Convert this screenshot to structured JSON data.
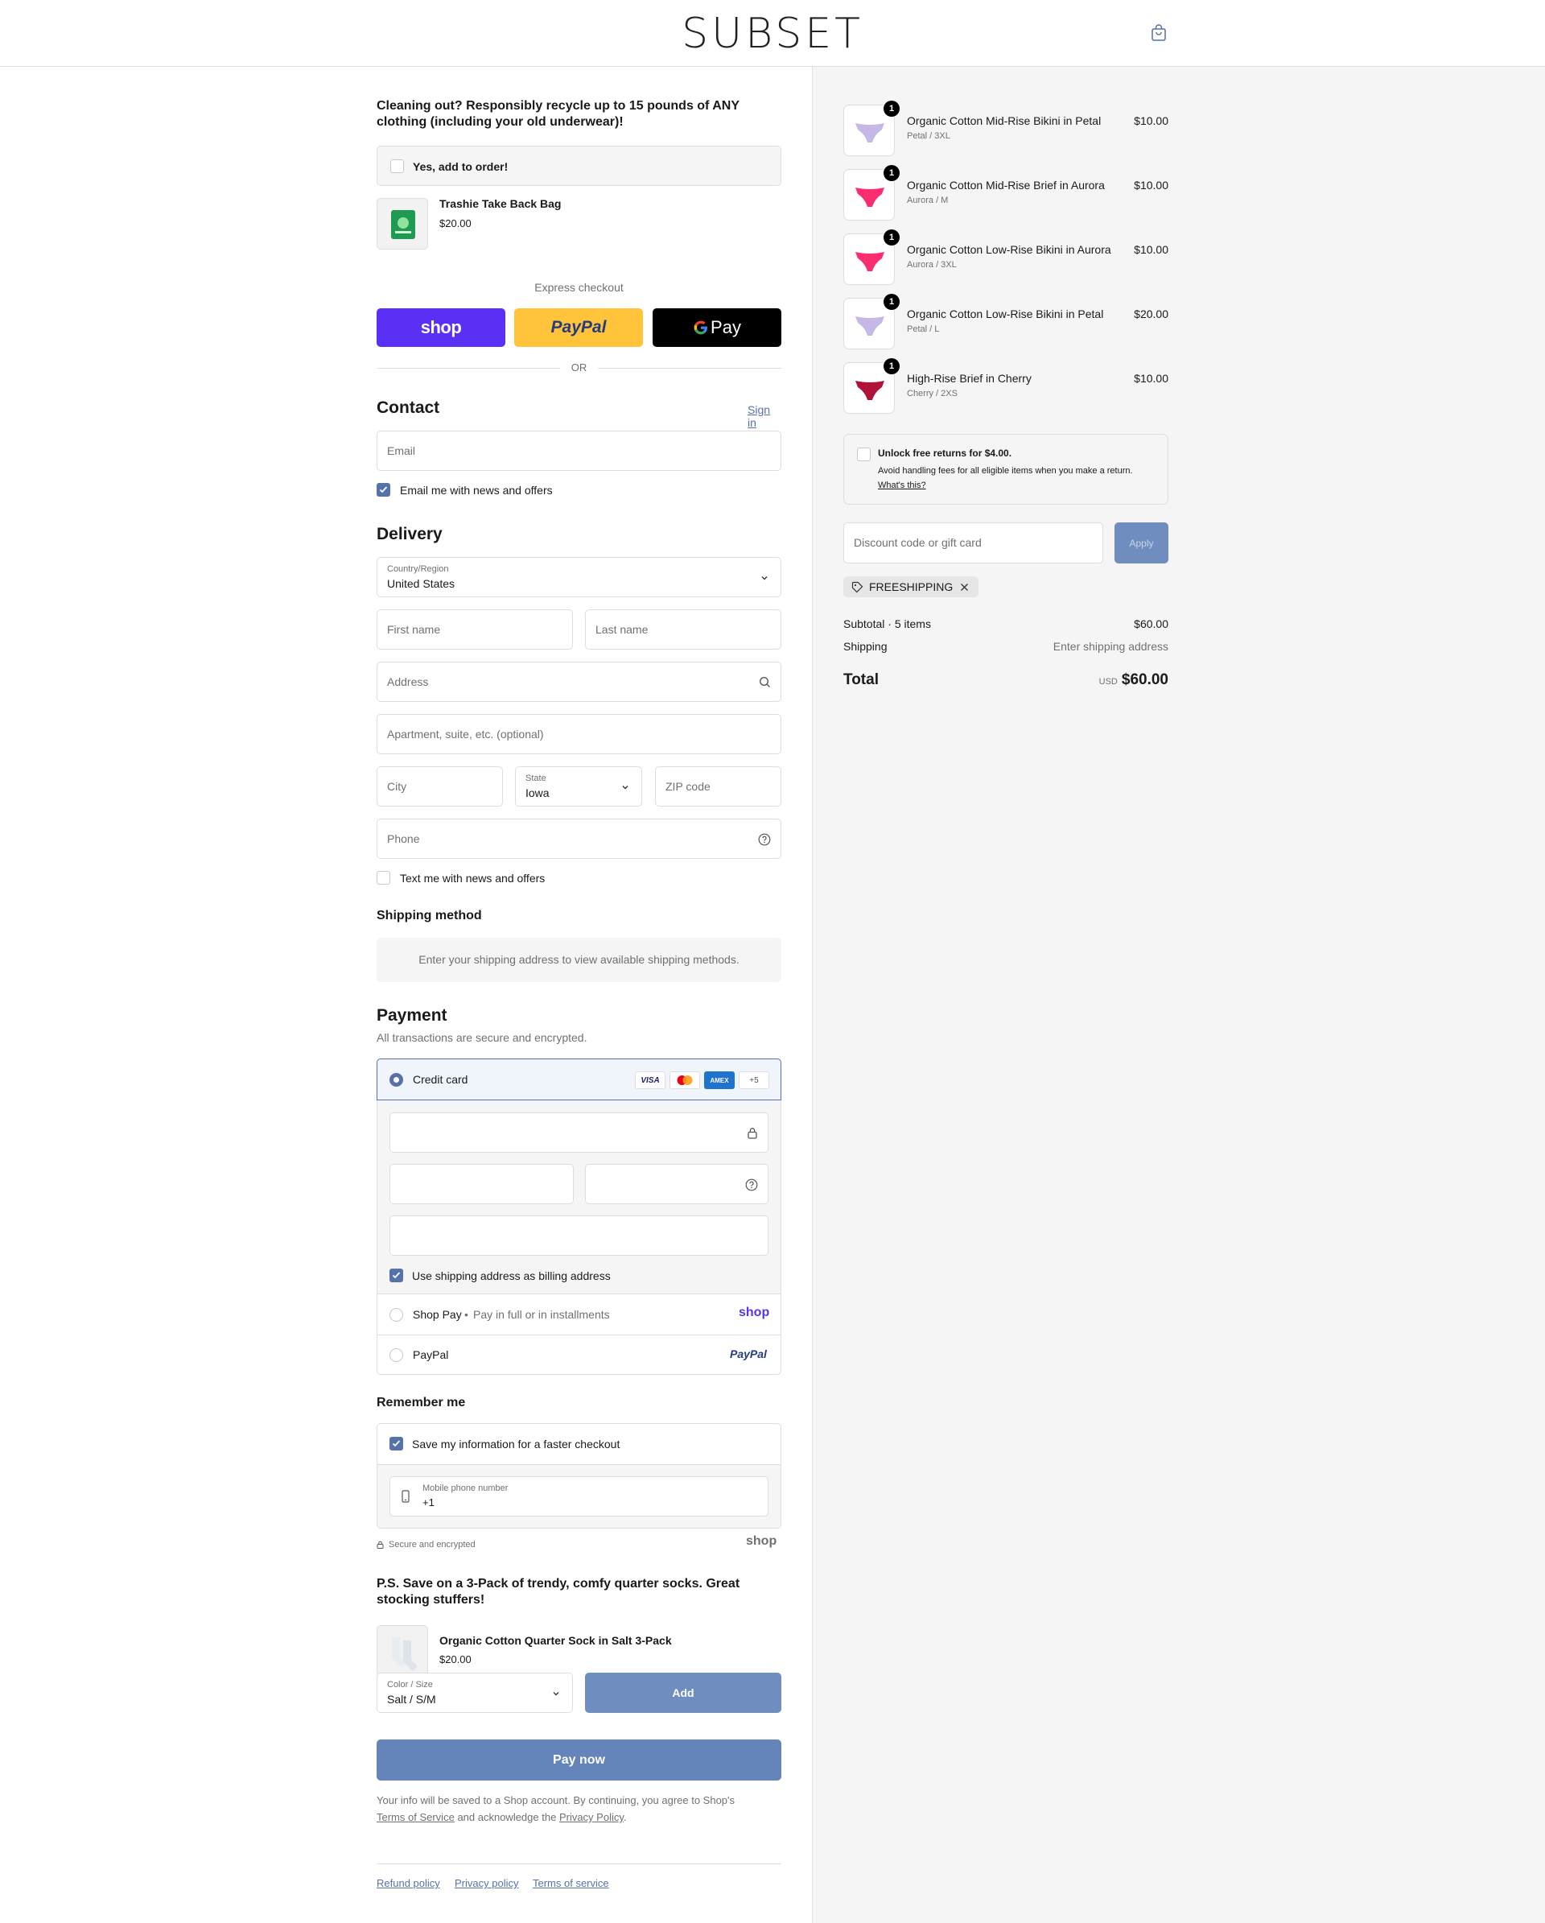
{
  "header": {
    "logo": "SUBSET",
    "cart_icon": "shopping-bag-icon"
  },
  "promo": {
    "title": "Cleaning out? Responsibly recycle up to 15 pounds of ANY clothing (including your old underwear)!",
    "add_label": "Yes, add to order!",
    "product_name": "Trashie Take Back Bag",
    "product_price": "$20.00"
  },
  "express": {
    "label": "Express checkout",
    "shop_label": "shop",
    "paypal_label": "PayPal",
    "gpay_label": "Pay",
    "or_label": "OR"
  },
  "contact": {
    "title": "Contact",
    "sign_in": "Sign in",
    "email_placeholder": "Email",
    "email_optin": "Email me with news and offers",
    "email_optin_checked": true
  },
  "delivery": {
    "title": "Delivery",
    "country_label": "Country/Region",
    "country_value": "United States",
    "first_name": "First name",
    "last_name": "Last name",
    "address": "Address",
    "apartment": "Apartment, suite, etc. (optional)",
    "city": "City",
    "state_label": "State",
    "state_value": "Iowa",
    "zip": "ZIP code",
    "phone": "Phone",
    "text_optin": "Text me with news and offers",
    "text_optin_checked": false
  },
  "shipping": {
    "title": "Shipping method",
    "note": "Enter your shipping address to view available shipping methods."
  },
  "payment": {
    "title": "Payment",
    "subtitle": "All transactions are secure and encrypted.",
    "credit_card": "Credit card",
    "cards": [
      "VISA",
      "mastercard",
      "AMEX",
      "+5"
    ],
    "billing_same": "Use shipping address as billing address",
    "billing_same_checked": true,
    "shop_pay": "Shop Pay",
    "shop_pay_sub": "Pay in full or in installments",
    "shop_pay_logo": "shop",
    "paypal": "PayPal",
    "paypal_logo": "PayPal"
  },
  "remember": {
    "title": "Remember me",
    "save_label": "Save my information for a faster checkout",
    "save_checked": true,
    "mobile_label": "Mobile phone number",
    "mobile_value": "+1",
    "secure_label": "Secure and encrypted",
    "shop_logo": "shop"
  },
  "upsell": {
    "title": "P.S. Save on a 3-Pack of trendy, comfy quarter socks. Great stocking stuffers!",
    "product_name": "Organic Cotton Quarter Sock in Salt 3-Pack",
    "product_price": "$20.00",
    "option_label": "Color / Size",
    "option_value": "Salt / S/M",
    "add_button": "Add"
  },
  "pay_now": "Pay now",
  "legal": {
    "text_1": "Your info will be saved to a Shop account. By continuing, you agree to Shop's",
    "tos": "Terms of Service",
    "text_2": "and acknowledge the",
    "privacy": "Privacy Policy",
    "text_3": "."
  },
  "footer": {
    "links": [
      "Refund policy",
      "Privacy policy",
      "Terms of service"
    ]
  },
  "summary": {
    "items": [
      {
        "name": "Organic Cotton Mid-Rise Bikini in Petal",
        "variant": "Petal / 3XL",
        "price": "$10.00",
        "qty": "1",
        "color": "#c6b7e6"
      },
      {
        "name": "Organic Cotton Mid-Rise Brief in Aurora",
        "variant": "Aurora / M",
        "price": "$10.00",
        "qty": "1",
        "color": "#fb2d6e"
      },
      {
        "name": "Organic Cotton Low-Rise Bikini in Aurora",
        "variant": "Aurora / 3XL",
        "price": "$10.00",
        "qty": "1",
        "color": "#fb2d6e"
      },
      {
        "name": "Organic Cotton Low-Rise Bikini in Petal",
        "variant": "Petal / L",
        "price": "$20.00",
        "qty": "1",
        "color": "#c6b7e6"
      },
      {
        "name": "High-Rise Brief in Cherry",
        "variant": "Cherry / 2XS",
        "price": "$10.00",
        "qty": "1",
        "color": "#b1123a"
      }
    ],
    "returns_title": "Unlock free returns for $4.00.",
    "returns_desc": "Avoid handling fees for all eligible items when you make a return.",
    "returns_link": "What's this?",
    "discount_placeholder": "Discount code or gift card",
    "apply": "Apply",
    "code": "FREESHIPPING",
    "subtotal_label": "Subtotal · 5 items",
    "subtotal_value": "$60.00",
    "shipping_label": "Shipping",
    "shipping_value": "Enter shipping address",
    "total_label": "Total",
    "currency": "USD",
    "total_value": "$60.00"
  },
  "colors": {
    "accent": "#5772a8",
    "shop_purple": "#5a31f4",
    "paypal_yellow": "#ffc439",
    "button_blue": "#6484ba"
  }
}
